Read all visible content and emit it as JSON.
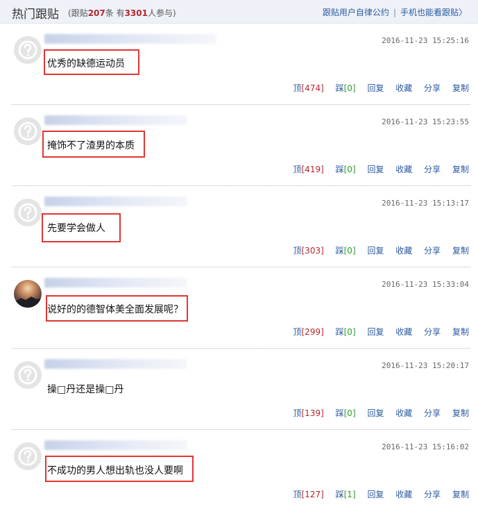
{
  "header": {
    "title": "热门跟贴",
    "stats_prefix": "(跟贴",
    "comment_count": "207",
    "stats_mid": "条 有",
    "participant_count": "3301",
    "stats_suffix": "人参与)",
    "rules_link": "跟贴用户自律公约",
    "separator": "|",
    "mobile_link": "手机也能看跟贴〉"
  },
  "labels": {
    "up": "顶",
    "down": "踩",
    "reply": "回复",
    "favorite": "收藏",
    "share": "分享",
    "copy": "复制"
  },
  "posts": [
    {
      "time": "2016-11-23 15:25:16",
      "content": "优秀的缺德运动员",
      "up": "[474]",
      "down": "[0]"
    },
    {
      "time": "2016-11-23 15:23:55",
      "content": "掩饰不了渣男的本质",
      "up": "[419]",
      "down": "[0]"
    },
    {
      "time": "2016-11-23 15:13:17",
      "content": "先要学会做人",
      "up": "[303]",
      "down": "[0]"
    },
    {
      "time": "2016-11-23 15:33:04",
      "content": "说好的的德智体美全面发展呢？",
      "up": "[299]",
      "down": "[0]"
    },
    {
      "time": "2016-11-23 15:20:17",
      "content": "操□丹还是操□丹",
      "up": "[139]",
      "down": "[0]"
    },
    {
      "time": "2016-11-23 15:16:02",
      "content": "不成功的男人想出轨也没人要啊",
      "up": "[127]",
      "down": "[1]"
    }
  ]
}
